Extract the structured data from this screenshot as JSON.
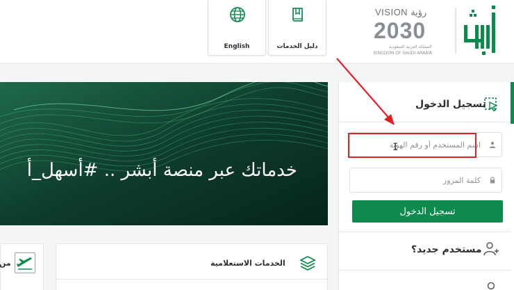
{
  "header": {
    "vision_top": "VISION رؤية",
    "vision_year": "2030",
    "vision_ar": "المملكة العربية السعودية",
    "vision_en": "KINGDOM OF SAUDI ARABIA",
    "english_label": "English",
    "guide_label": "دليل الخدمات"
  },
  "banner": {
    "text": "خدماتك عبر منصة أبشر .. #أسهل_أ"
  },
  "login": {
    "title": "تسجيل الدخول",
    "username_placeholder": "اسم المستخدم أو رقم الهوية",
    "password_placeholder": "كلمة المرور",
    "submit_label": "تسجيل الدخول",
    "new_user": "مستخدم جديد؟"
  },
  "cards": {
    "inquiry_title": "الخدمات الاستعلامية",
    "left_partial": "من"
  },
  "colors": {
    "brand_green": "#0e8a4e",
    "banner_dark": "#0f3a2c",
    "annotation_red": "#e31e24"
  },
  "icons": {
    "globe": "globe-icon",
    "book": "book-icon",
    "login": "login-cursor-icon",
    "user": "user-icon",
    "lock": "lock-icon",
    "add_user": "add-user-icon",
    "layers": "layers-icon",
    "plane": "plane-icon"
  }
}
